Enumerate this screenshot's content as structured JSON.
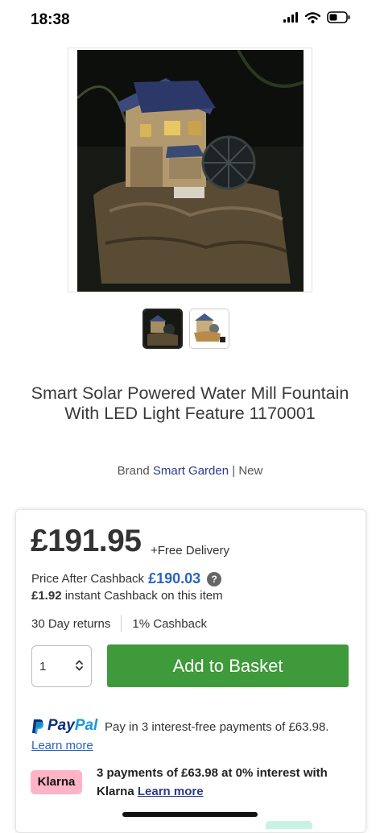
{
  "status": {
    "time": "18:38"
  },
  "product": {
    "title": "Smart Solar Powered Water Mill Fountain With LED Light Feature 1170001",
    "brand_prefix": "Brand",
    "brand_name": "Smart Garden",
    "brand_sep": "|",
    "condition": "New"
  },
  "purchase": {
    "price": "£191.95",
    "delivery": "+Free Delivery",
    "cashback_label": "Price After Cashback",
    "cashback_price": "£190.03",
    "help_symbol": "?",
    "instant_amount": "£1.92",
    "instant_text": "instant Cashback on this item",
    "returns": "30 Day returns",
    "cashback_pct": "1% Cashback",
    "quantity": "1",
    "add_button": "Add to Basket"
  },
  "paypal": {
    "logo_pay": "Pay",
    "logo_pal": "Pal",
    "text": "Pay in 3 interest-free payments of £63.98.",
    "learn_more": "Learn more"
  },
  "klarna": {
    "badge": "Klarna",
    "text_a": "3 payments of",
    "amount": "£63.98",
    "text_b": "at 0% interest with Klarna",
    "learn_more": "Learn more"
  },
  "icons": [
    "signal-icon",
    "wifi-icon",
    "battery-icon",
    "help-icon",
    "chevron-up-down-icon",
    "paypal-icon"
  ],
  "colors": {
    "add_button": "#3e9a3a",
    "cashback_price": "#2a64c0",
    "brand_link": "#2c3a88",
    "klarna_badge": "#ffb3c7"
  }
}
